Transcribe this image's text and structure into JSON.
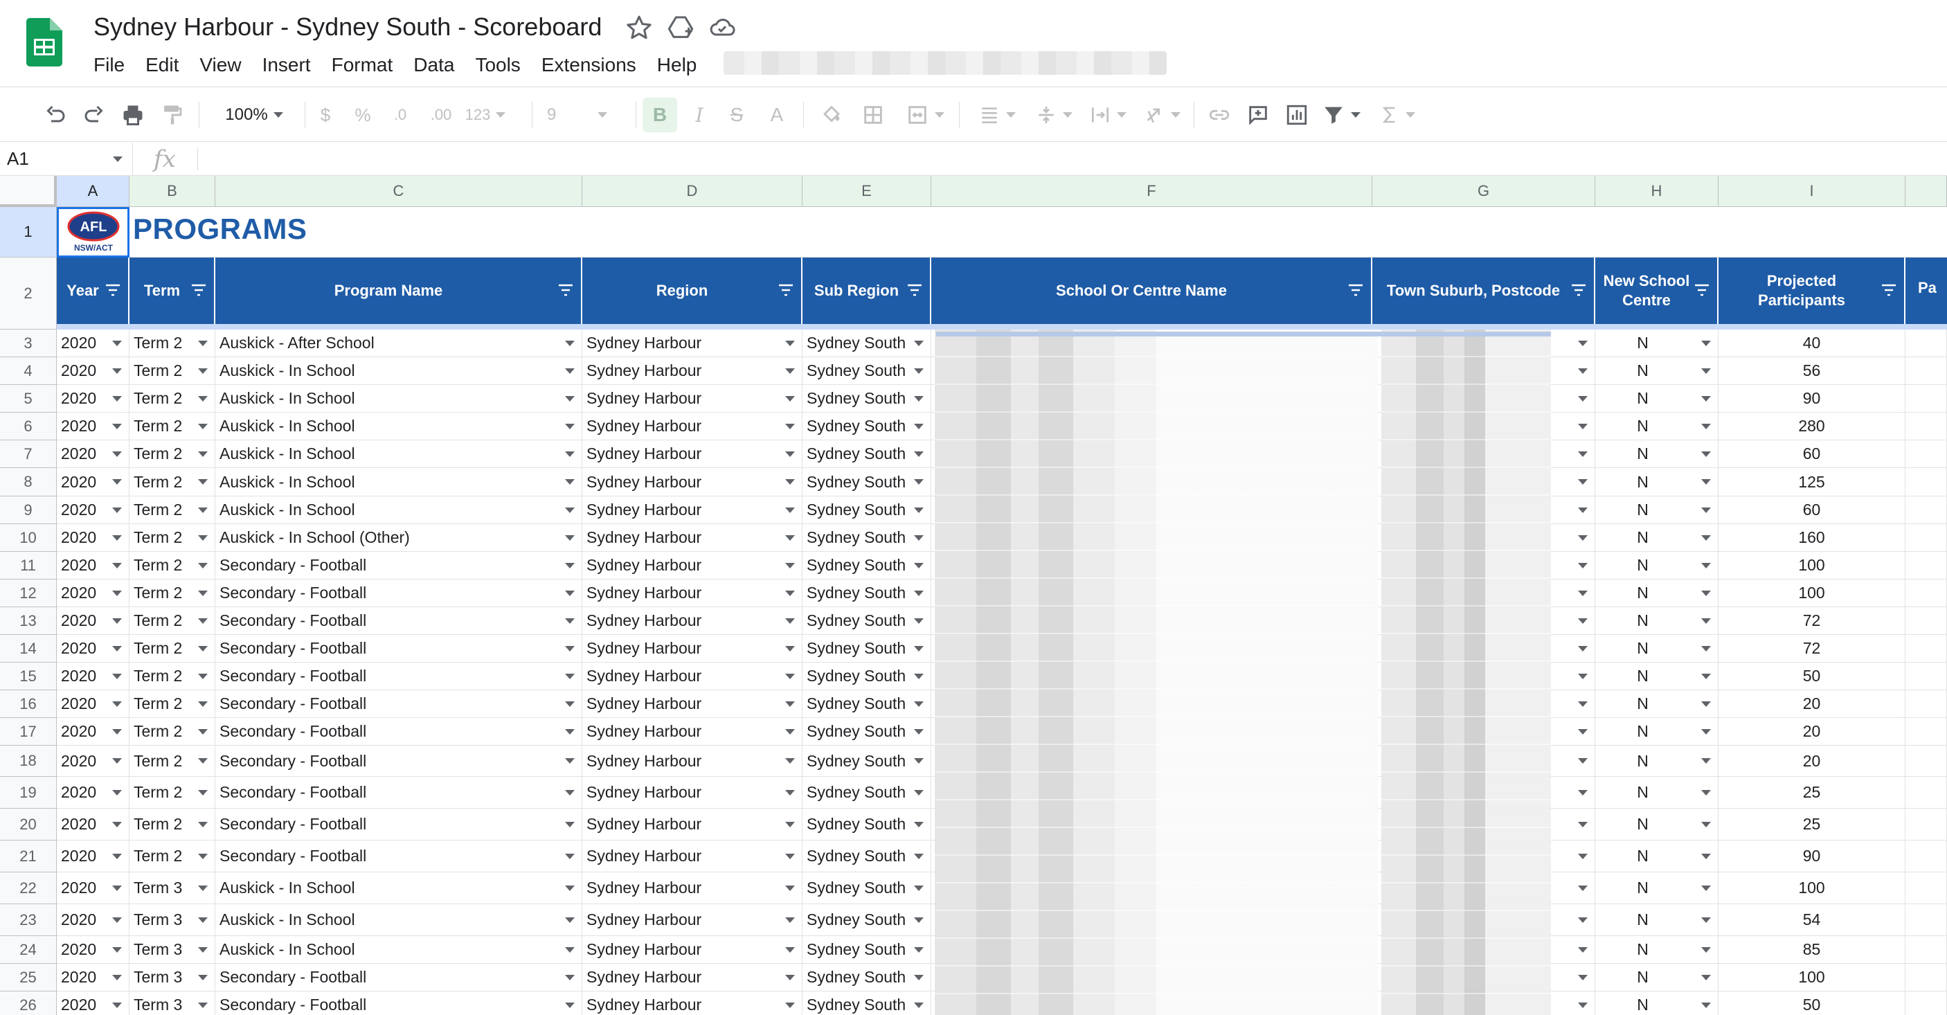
{
  "document": {
    "title": "Sydney Harbour - Sydney South - Scoreboard",
    "menu": [
      "File",
      "Edit",
      "View",
      "Insert",
      "Format",
      "Data",
      "Tools",
      "Extensions",
      "Help"
    ]
  },
  "toolbar": {
    "zoom": "100%",
    "currency": "$",
    "percent": "%",
    "decrease_decimal": ".0",
    "increase_decimal": ".00",
    "more_formats": "123",
    "font_size": "9",
    "bold": "B",
    "italic": "I",
    "strike": "S",
    "text_color": "A"
  },
  "formula_bar": {
    "cell_ref": "A1",
    "fx": "fx",
    "content": ""
  },
  "colors": {
    "header_blue": "#1f5ca7",
    "sheets_green": "#0f9d58",
    "selected_blue": "#d3e3fd"
  },
  "sheet": {
    "column_letters": [
      "A",
      "B",
      "C",
      "D",
      "E",
      "F",
      "G",
      "H",
      "I"
    ],
    "row_numbers": [
      "1",
      "2",
      "3",
      "4",
      "5",
      "6",
      "7",
      "8",
      "9",
      "10",
      "11",
      "12",
      "13",
      "14",
      "15",
      "16",
      "17",
      "18",
      "19",
      "20",
      "21",
      "22",
      "23",
      "24",
      "25",
      "26"
    ],
    "logo_text": "AFL",
    "logo_subtext": "NSW/ACT",
    "title": "PROGRAMS",
    "headers": [
      "Year",
      "Term",
      "Program Name",
      "Region",
      "Sub Region",
      "School Or Centre Name",
      "Town Suburb, Postcode",
      "New School Centre",
      "Projected Participants",
      "Pa"
    ],
    "rows": [
      [
        "2020",
        "Term 2",
        "Auskick - After School",
        "Sydney Harbour",
        "Sydney South",
        "N",
        "40"
      ],
      [
        "2020",
        "Term 2",
        "Auskick - In School",
        "Sydney Harbour",
        "Sydney South",
        "N",
        "56"
      ],
      [
        "2020",
        "Term 2",
        "Auskick - In School",
        "Sydney Harbour",
        "Sydney South",
        "N",
        "90"
      ],
      [
        "2020",
        "Term 2",
        "Auskick - In School",
        "Sydney Harbour",
        "Sydney South",
        "N",
        "280"
      ],
      [
        "2020",
        "Term 2",
        "Auskick - In School",
        "Sydney Harbour",
        "Sydney South",
        "N",
        "60"
      ],
      [
        "2020",
        "Term 2",
        "Auskick - In School",
        "Sydney Harbour",
        "Sydney South",
        "N",
        "125"
      ],
      [
        "2020",
        "Term 2",
        "Auskick - In School",
        "Sydney Harbour",
        "Sydney South",
        "N",
        "60"
      ],
      [
        "2020",
        "Term 2",
        "Auskick - In School (Other)",
        "Sydney Harbour",
        "Sydney South",
        "N",
        "160"
      ],
      [
        "2020",
        "Term 2",
        "Secondary - Football",
        "Sydney Harbour",
        "Sydney South",
        "N",
        "100"
      ],
      [
        "2020",
        "Term 2",
        "Secondary - Football",
        "Sydney Harbour",
        "Sydney South",
        "N",
        "100"
      ],
      [
        "2020",
        "Term 2",
        "Secondary - Football",
        "Sydney Harbour",
        "Sydney South",
        "N",
        "72"
      ],
      [
        "2020",
        "Term 2",
        "Secondary - Football",
        "Sydney Harbour",
        "Sydney South",
        "N",
        "72"
      ],
      [
        "2020",
        "Term 2",
        "Secondary - Football",
        "Sydney Harbour",
        "Sydney South",
        "N",
        "50"
      ],
      [
        "2020",
        "Term 2",
        "Secondary - Football",
        "Sydney Harbour",
        "Sydney South",
        "N",
        "20"
      ],
      [
        "2020",
        "Term 2",
        "Secondary - Football",
        "Sydney Harbour",
        "Sydney South",
        "N",
        "20"
      ],
      [
        "2020",
        "Term 2",
        "Secondary - Football",
        "Sydney Harbour",
        "Sydney South",
        "N",
        "20"
      ],
      [
        "2020",
        "Term 2",
        "Secondary - Football",
        "Sydney Harbour",
        "Sydney South",
        "N",
        "25"
      ],
      [
        "2020",
        "Term 2",
        "Secondary - Football",
        "Sydney Harbour",
        "Sydney South",
        "N",
        "25"
      ],
      [
        "2020",
        "Term 2",
        "Secondary - Football",
        "Sydney Harbour",
        "Sydney South",
        "N",
        "90"
      ],
      [
        "2020",
        "Term 3",
        "Auskick - In School",
        "Sydney Harbour",
        "Sydney South",
        "N",
        "100"
      ],
      [
        "2020",
        "Term 3",
        "Auskick - In School",
        "Sydney Harbour",
        "Sydney South",
        "N",
        "54"
      ],
      [
        "2020",
        "Term 3",
        "Auskick - In School",
        "Sydney Harbour",
        "Sydney South",
        "N",
        "85"
      ],
      [
        "2020",
        "Term 3",
        "Secondary - Football",
        "Sydney Harbour",
        "Sydney South",
        "N",
        "100"
      ],
      [
        "2020",
        "Term 3",
        "Secondary - Football",
        "Sydney Harbour",
        "Sydney South",
        "N",
        "50"
      ]
    ]
  }
}
